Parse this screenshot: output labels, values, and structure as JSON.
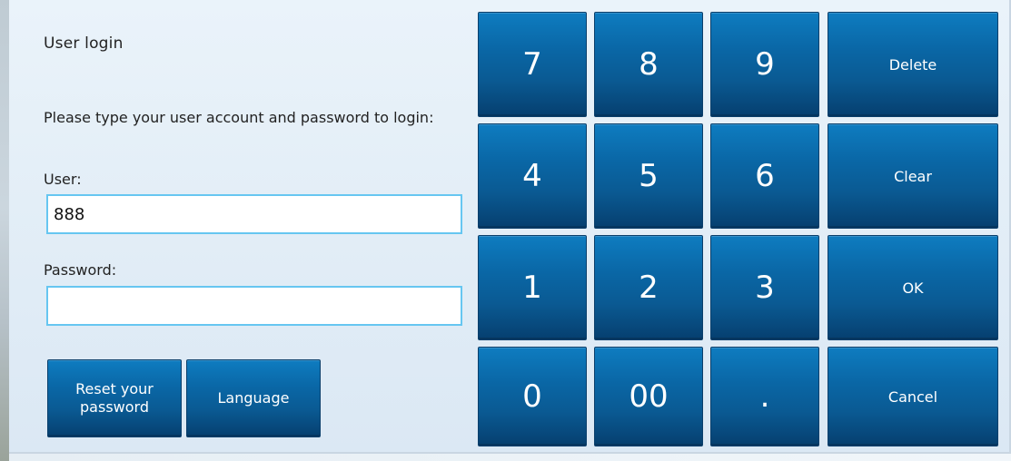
{
  "login": {
    "title": "User login",
    "instructions": "Please type your user account and password to login:",
    "user_label": "User:",
    "user_value": "888",
    "password_label": "Password:",
    "password_value": ""
  },
  "actions": {
    "reset_password_label": "Reset your password",
    "language_label": "Language"
  },
  "keypad": {
    "keys": [
      [
        "7",
        "8",
        "9",
        "Delete"
      ],
      [
        "4",
        "5",
        "6",
        "Clear"
      ],
      [
        "1",
        "2",
        "3",
        "OK"
      ],
      [
        "0",
        "00",
        ".",
        "Cancel"
      ]
    ]
  },
  "colors": {
    "button_blue_top": "#0e7cc0",
    "button_blue_bottom": "#063f6f",
    "input_border": "#66c6f1",
    "panel_background": "#e3eef7"
  }
}
